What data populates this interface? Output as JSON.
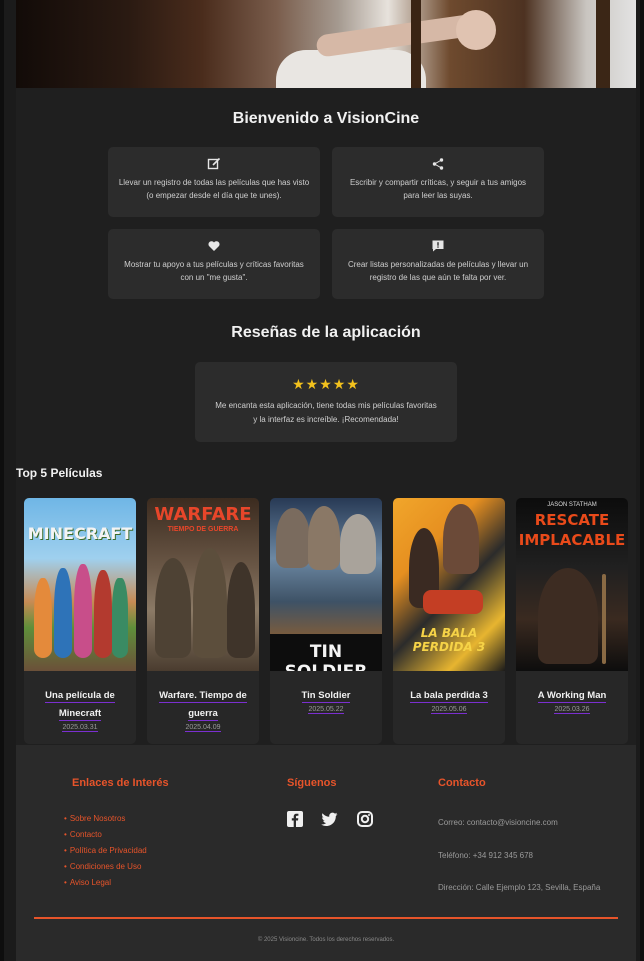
{
  "welcome": {
    "title": "Bienvenido a VisionCine",
    "features": [
      {
        "icon": "edit-icon",
        "text": "Llevar un registro de todas las películas que has visto (o empezar desde el día que te unes)."
      },
      {
        "icon": "share-icon",
        "text": "Escribir y compartir críticas, y seguir a tus amigos para leer las suyas."
      },
      {
        "icon": "heart-icon",
        "text": "Mostrar tu apoyo a tus películas y críticas favoritas con un \"me gusta\"."
      },
      {
        "icon": "list-icon",
        "text": "Crear listas personalizadas de películas y llevar un registro de las que aún te falta por ver."
      }
    ]
  },
  "reviews": {
    "title": "Reseñas de la aplicación",
    "stars": "★★★★★",
    "text": "Me encanta esta aplicación, tiene todas mis películas favoritas y la interfaz es increíble. ¡Recomendada!"
  },
  "top": {
    "title": "Top 5 Películas",
    "movies": [
      {
        "title": "Una película de Minecraft",
        "date": "2025.03.31",
        "poster_text": "MINECRAFT"
      },
      {
        "title": "Warfare. Tiempo de guerra",
        "date": "2025.04.09",
        "poster_text": "WARFARE",
        "poster_sub": "TIEMPO DE GUERRA"
      },
      {
        "title": "Tin Soldier",
        "date": "2025.05.22",
        "poster_text": "TIN SOLDIER"
      },
      {
        "title": "La bala perdida 3",
        "date": "2025.05.06",
        "poster_text": "LA BALA PERDIDA 3"
      },
      {
        "title": "A Working Man",
        "date": "2025.03.26",
        "poster_name": "JASON STATHAM",
        "poster_text": "RESCATE IMPLACABLE"
      }
    ]
  },
  "footer": {
    "links_title": "Enlaces de Interés",
    "links": [
      "Sobre Nosotros",
      "Contacto",
      "Política de Privacidad",
      "Condiciones de Uso",
      "Aviso Legal"
    ],
    "social_title": "Síguenos",
    "social": [
      "facebook-icon",
      "twitter-icon",
      "instagram-icon"
    ],
    "contact_title": "Contacto",
    "email": "Correo: contacto@visioncine.com",
    "phone": "Teléfono: +34 912 345 678",
    "address": "Dirección: Calle Ejemplo 123, Sevilla, España",
    "copyright": "© 2025 Visioncine. Todos los derechos reservados."
  },
  "colors": {
    "accent": "#e7542a",
    "underline": "#7b2fd0",
    "star": "#f2c11d",
    "background": "#1f1f1f",
    "card": "#2c2c2c"
  }
}
